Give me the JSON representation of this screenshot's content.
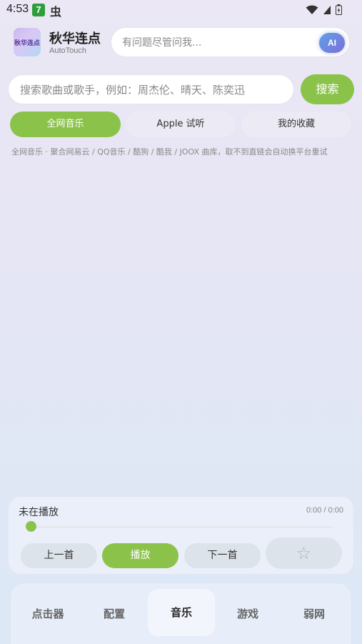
{
  "status_bar": {
    "time": "4:53",
    "notification_badge": "7",
    "bug_glyph": "虫"
  },
  "header": {
    "app_logo_text": "秋华连点",
    "app_title": "秋华连点",
    "app_subtitle": "AutoTouch",
    "ai_placeholder": "有问题尽管问我...",
    "ai_button": "AI"
  },
  "search": {
    "placeholder": "搜索歌曲或歌手，例如：周杰伦、晴天、陈奕迅",
    "button_label": "搜索"
  },
  "tabs": [
    {
      "label": "全网音乐",
      "active": true
    },
    {
      "label": "Apple 试听",
      "active": false
    },
    {
      "label": "我的收藏",
      "active": false
    }
  ],
  "source_note": "全网音乐 · 聚合网易云 / QQ音乐 / 酷狗 / 酷我 / JOOX 曲库，取不到直链会自动换平台重试",
  "player": {
    "status": "未在播放",
    "time_readout": "0:00 / 0:00",
    "progress_fraction": 0,
    "prev_label": "上一首",
    "play_label": "播放",
    "next_label": "下一首",
    "favorite_icon": "star-outline-icon",
    "favorite_glyph": "☆"
  },
  "bottom_nav": [
    {
      "label": "点击器",
      "active": false
    },
    {
      "label": "配置",
      "active": false
    },
    {
      "label": "音乐",
      "active": true
    },
    {
      "label": "游戏",
      "active": false
    },
    {
      "label": "弱网",
      "active": false
    }
  ],
  "colors": {
    "accent_green": "#8bc34a",
    "ai_gradient_start": "#5fa0e8",
    "ai_gradient_end": "#7c6fd8"
  }
}
